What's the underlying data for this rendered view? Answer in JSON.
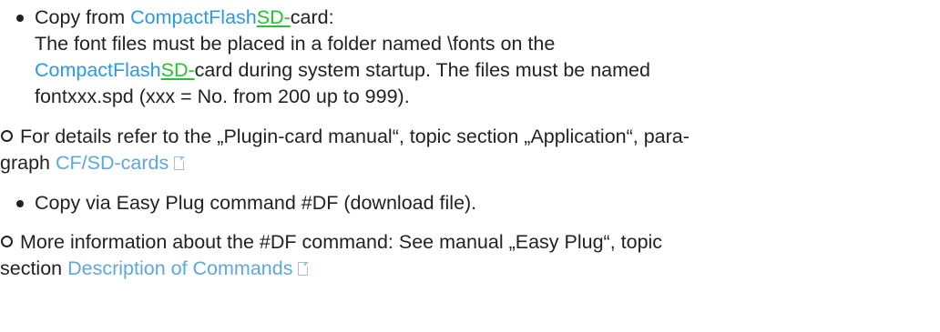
{
  "items": [
    {
      "type": "bullet",
      "line1": {
        "prefix": "Copy from ",
        "cf_link": "CompactFlash",
        "sd_insert": "SD-",
        "suffix": "card:"
      },
      "line2": "The font files must be placed in a folder named \\fonts on the",
      "line3": {
        "cf_link": "CompactFlash",
        "sd_insert": "SD-",
        "suffix": "card during system startup. The files must be named"
      },
      "line4": "fontxxx.spd (xxx = No. from 200 up to 999)."
    },
    {
      "type": "note",
      "line1": "For details refer to the „Plugin-card manual“, topic section „Application“, para-",
      "line2_prefix": "graph ",
      "link": "CF/SD-cards",
      "icon": "page-reference-icon"
    },
    {
      "type": "bullet",
      "text": "Copy via Easy Plug command #DF (download file)."
    },
    {
      "type": "note",
      "line1": "More information about the #DF command: See manual „Easy Plug“, topic",
      "line2_prefix": "section ",
      "link": "Description of Commands",
      "icon": "page-reference-icon"
    }
  ],
  "colors": {
    "text": "#222222",
    "link_blue": "#2b9be0",
    "link_light": "#5fa8d8",
    "sd_insert_green": "#27c22f"
  }
}
